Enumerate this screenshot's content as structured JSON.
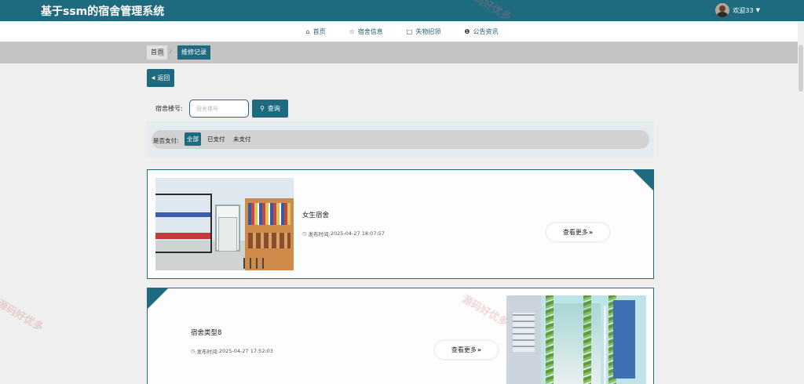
{
  "header": {
    "title": "基于ssm的宿舍管理系统",
    "welcome": "欢迎33",
    "caret": "▼"
  },
  "nav": [
    {
      "label": "首页",
      "icon": "home-icon",
      "glyph": "⌂"
    },
    {
      "label": "宿舍信息",
      "icon": "star-icon",
      "glyph": "☆"
    },
    {
      "label": "失物招领",
      "icon": "bag-icon",
      "glyph": "🔒︎"
    },
    {
      "label": "公告资讯",
      "icon": "info-icon",
      "glyph": "❶"
    }
  ],
  "breadcrumb": {
    "home": "首页",
    "separator": "/",
    "current": "维修记录"
  },
  "back_button": {
    "label": "返回",
    "glyph": "◀"
  },
  "search": {
    "label": "宿舍楼号:",
    "placeholder": "宿舍楼号",
    "value": "",
    "button_label": "查询",
    "button_glyph": "⚲"
  },
  "filter": {
    "label": "是否支付:",
    "options": [
      {
        "label": "全部",
        "active": true
      },
      {
        "label": "已支付",
        "active": false
      },
      {
        "label": "未支付",
        "active": false
      }
    ]
  },
  "cards": [
    {
      "title": "女生宿舍",
      "time_prefix": "发布时间:",
      "time": "2025-04-27 18:07:57",
      "more": "查看更多",
      "more_arrow": "»"
    },
    {
      "title": "宿舍类型8",
      "time_prefix": "发布时间:",
      "time": "2025-04-27 17:52:03",
      "more": "查看更多",
      "more_arrow": "»"
    }
  ],
  "watermark": "源码好优多",
  "colors": {
    "primary": "#1e6b80",
    "breadcrumb_bar": "#c4c4c4",
    "background": "#efefef"
  }
}
